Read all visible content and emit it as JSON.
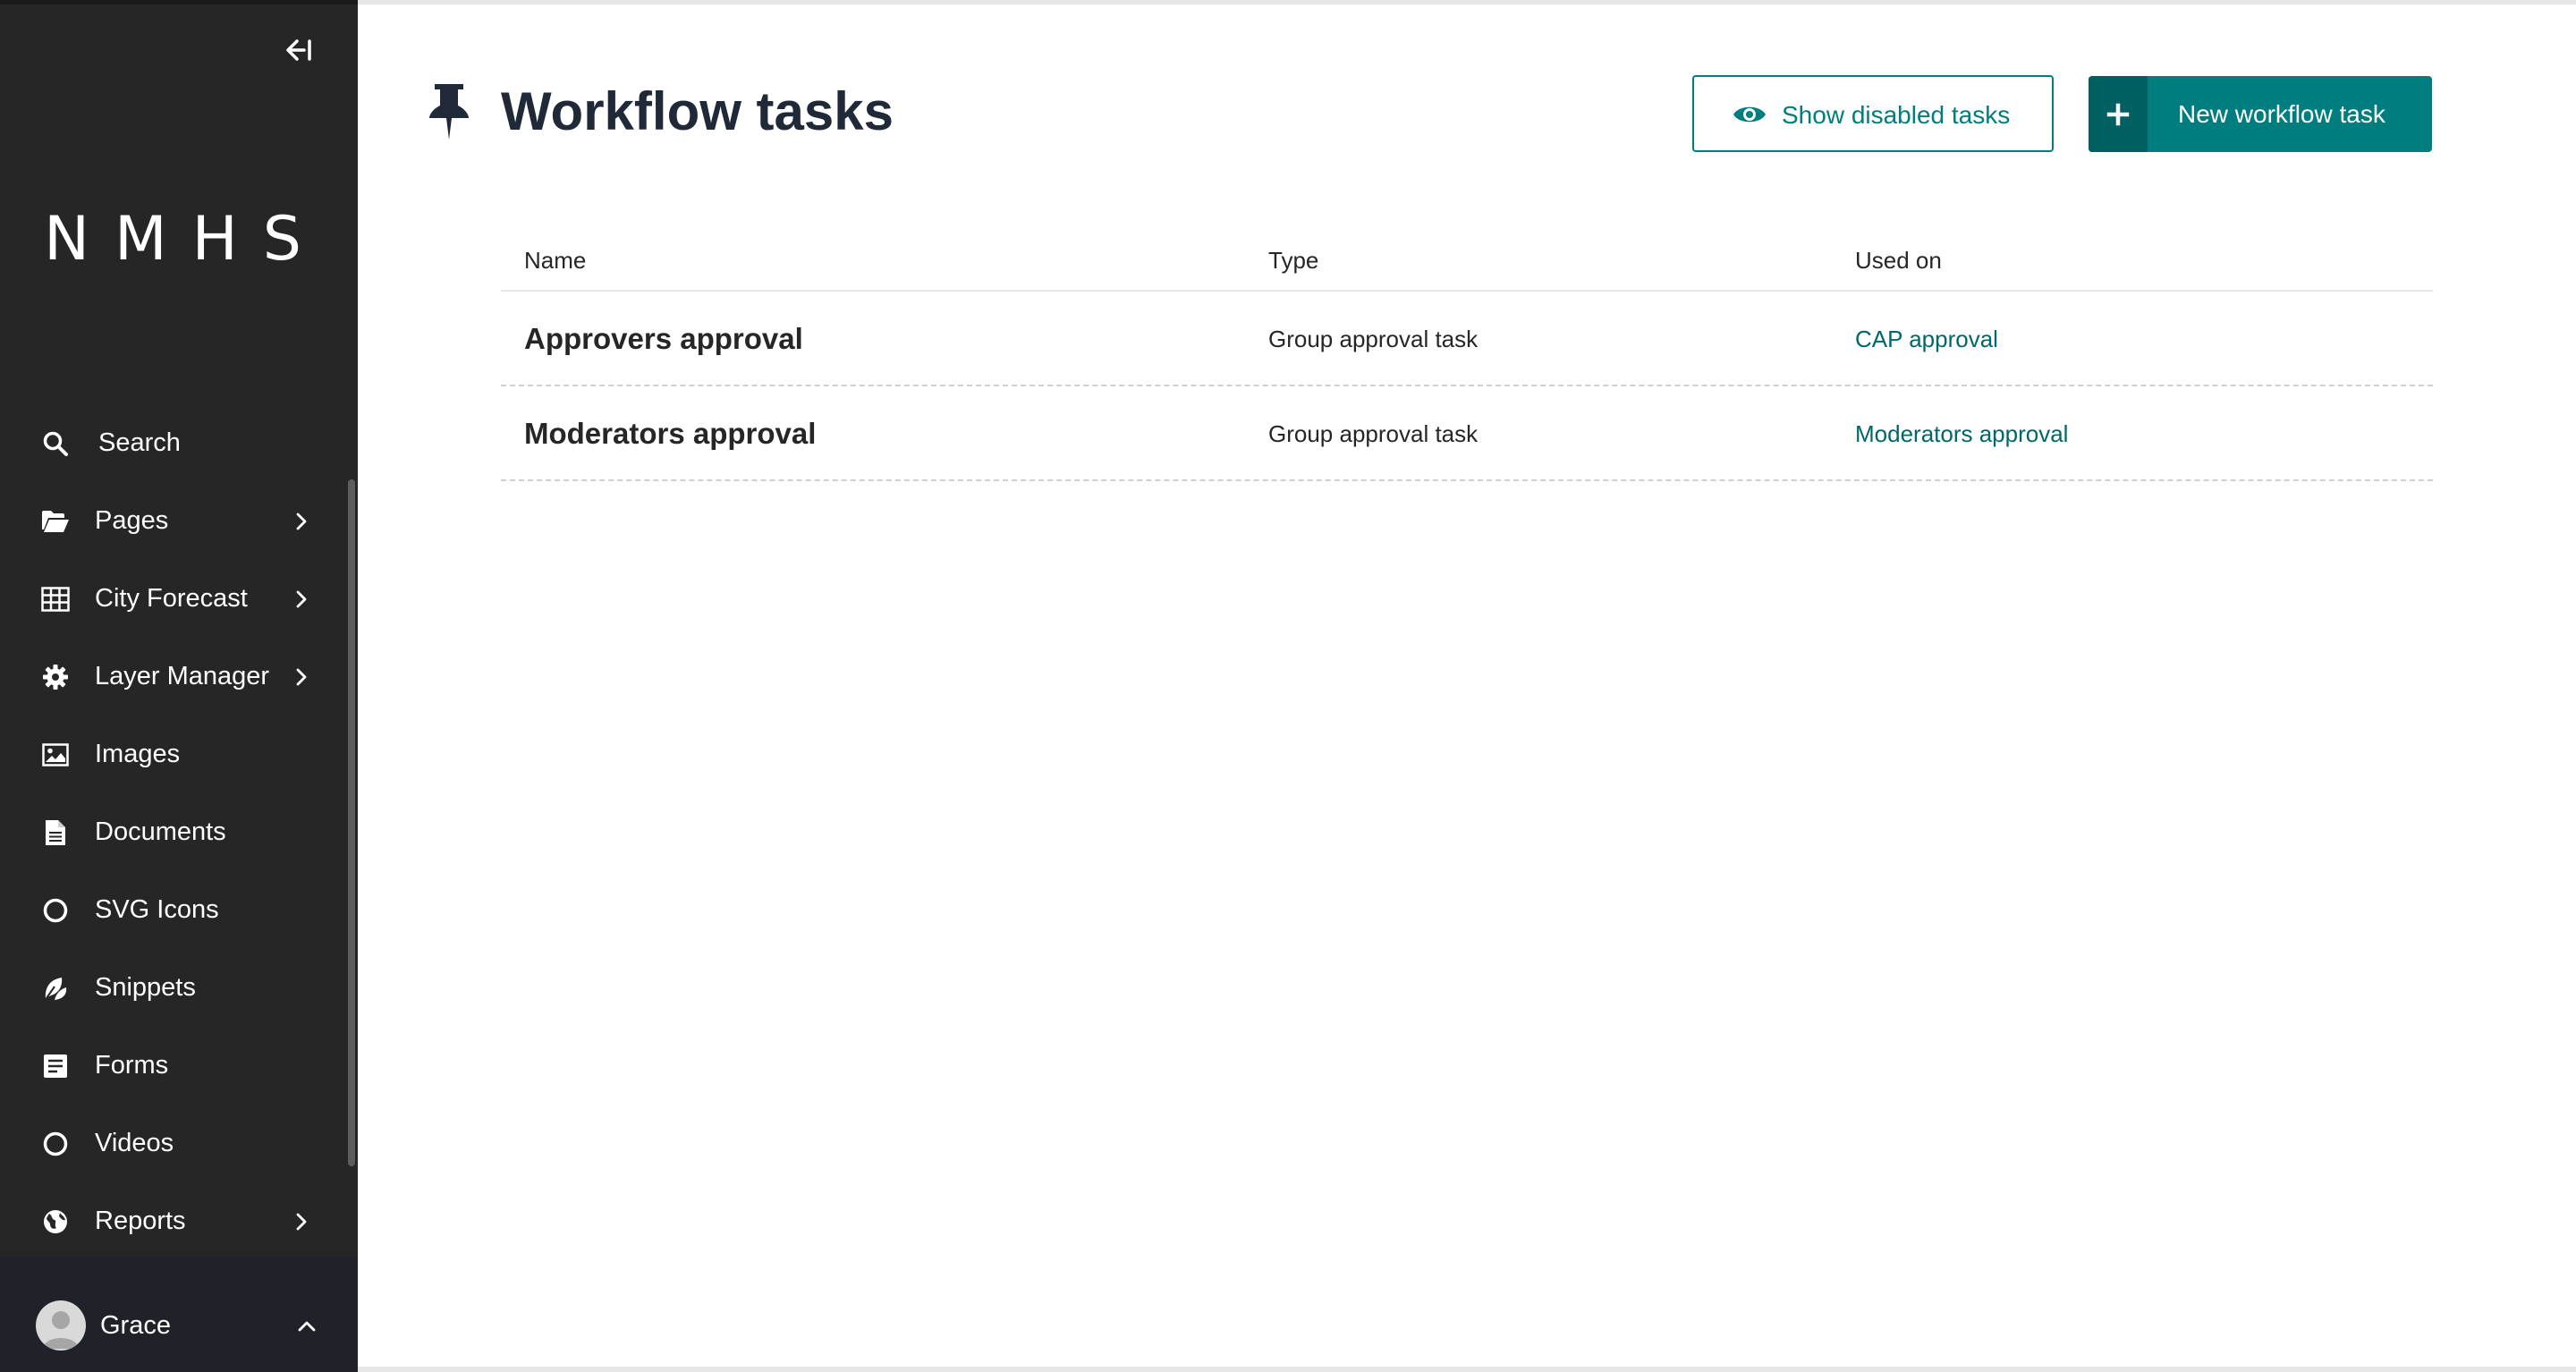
{
  "sidebar": {
    "logo": "NMHS",
    "items": [
      {
        "label": "Search",
        "icon": "search-icon"
      },
      {
        "label": "Pages",
        "icon": "folder-open-icon",
        "has_submenu": true
      },
      {
        "label": "City Forecast",
        "icon": "table-icon",
        "has_submenu": true
      },
      {
        "label": "Layer Manager",
        "icon": "gear-icon",
        "has_submenu": true
      },
      {
        "label": "Images",
        "icon": "image-icon"
      },
      {
        "label": "Documents",
        "icon": "document-icon"
      },
      {
        "label": "SVG Icons",
        "icon": "circle-icon"
      },
      {
        "label": "Snippets",
        "icon": "snippet-icon"
      },
      {
        "label": "Forms",
        "icon": "form-icon"
      },
      {
        "label": "Videos",
        "icon": "circle-icon"
      },
      {
        "label": "Reports",
        "icon": "globe-icon",
        "has_submenu": true
      }
    ],
    "account": {
      "name": "Grace"
    }
  },
  "header": {
    "title": "Workflow tasks",
    "icon": "pushpin-icon",
    "show_disabled_label": "Show disabled tasks",
    "new_task_label": "New workflow task"
  },
  "table": {
    "columns": [
      "Name",
      "Type",
      "Used on"
    ],
    "rows": [
      {
        "name": "Approvers approval",
        "type": "Group approval task",
        "used_on": "CAP approval"
      },
      {
        "name": "Moderators approval",
        "type": "Group approval task",
        "used_on": "Moderators approval"
      }
    ]
  },
  "colors": {
    "sidebar_bg": "#262626",
    "account_bg": "#1f2329",
    "accent": "#007d7e",
    "accent_dark": "#006061",
    "link": "#00676a"
  }
}
